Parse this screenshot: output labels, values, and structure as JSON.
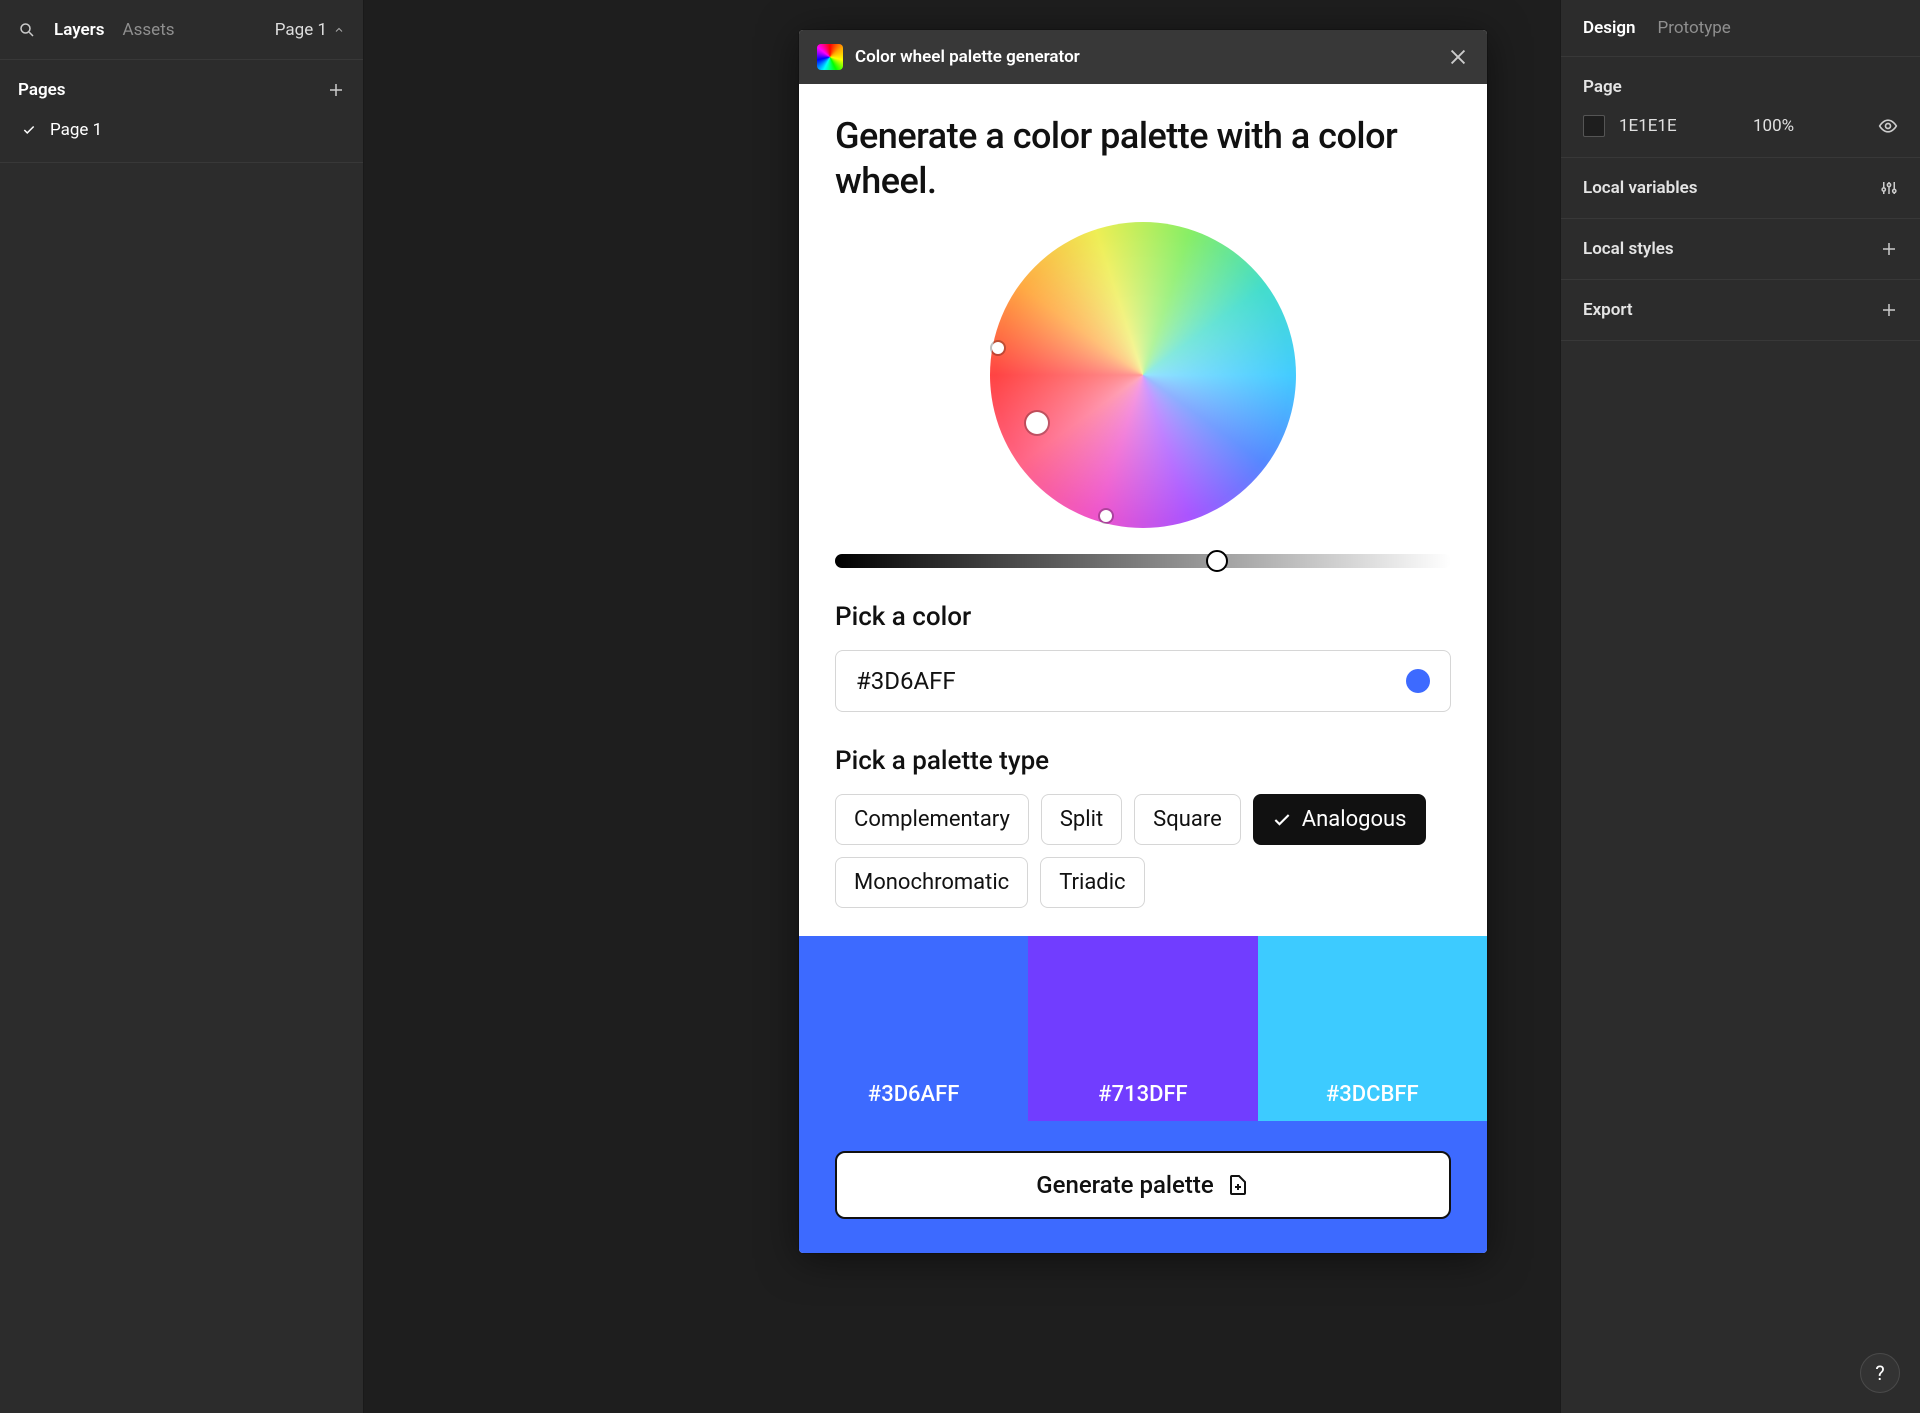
{
  "left": {
    "tabs": {
      "layers": "Layers",
      "assets": "Assets"
    },
    "page_button": "Page 1",
    "pages_header": "Pages",
    "pages": [
      {
        "name": "Page 1"
      }
    ]
  },
  "right": {
    "tabs": {
      "design": "Design",
      "prototype": "Prototype"
    },
    "page_section": {
      "title": "Page",
      "bg_hex": "1E1E1E",
      "opacity": "100%"
    },
    "local_variables": "Local variables",
    "local_styles": "Local styles",
    "export": "Export"
  },
  "plugin": {
    "title": "Color wheel palette generator",
    "headline": "Generate a color palette with a color wheel.",
    "pick_color_label": "Pick a color",
    "color_hex": "#3D6AFF",
    "swatch_color": "#3d6aff",
    "pick_palette_label": "Pick a palette type",
    "palette_types": {
      "complementary": "Complementary",
      "split": "Split",
      "square": "Square",
      "analogous": "Analogous",
      "monochromatic": "Monochromatic",
      "triadic": "Triadic"
    },
    "active_palette_type": "analogous",
    "swatches": [
      {
        "hex": "#3D6AFF",
        "color": "#3d6aff"
      },
      {
        "hex": "#713DFF",
        "color": "#713dff"
      },
      {
        "hex": "#3DCBFF",
        "color": "#3dcbff"
      }
    ],
    "generate_label": "Generate palette",
    "brightness_pos_pct": 62,
    "generate_bar_bg": "#3d6aff"
  },
  "help": "?"
}
